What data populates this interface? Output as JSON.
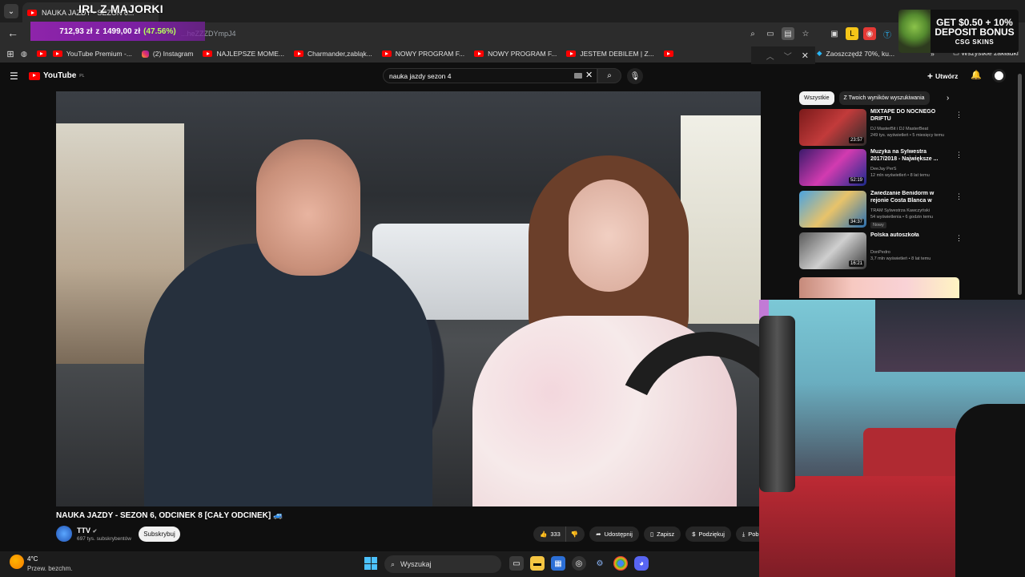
{
  "browser": {
    "tab_title": "NAUKA JAZDY - SEZON 6...",
    "address": "...heZZZDYmpJ4",
    "bookmarks": [
      {
        "label": "YouTube Premium -..."
      },
      {
        "label": "(2) Instagram"
      },
      {
        "label": "NAJLEPSZE MOME..."
      },
      {
        "label": "Charmander,zabląk..."
      },
      {
        "label": "NOWY PROGRAM F..."
      },
      {
        "label": "NOWY PROGRAM F..."
      },
      {
        "label": "JESTEM DEBILEM | Z..."
      }
    ],
    "bookmark_right": "Zaoszczędź 70%, ku...",
    "all_bookmarks": "Wszystkie zakładki"
  },
  "overlay": {
    "stream_title": "IRL Z MAJORKI",
    "donation_current": "712,93 zł",
    "donation_sep": "z",
    "donation_goal": "1499,00 zł",
    "donation_pct": "(47.56%)",
    "promo_line1": "GET $0.50 + 10%",
    "promo_line2": "DEPOSIT BONUS",
    "promo_brand": "CSG SKINS"
  },
  "youtube": {
    "logo": "YouTube",
    "logo_region": "PL",
    "search_query": "nauka jazdy sezon 4",
    "create_label": "Utwórz",
    "video_title": "NAUKA JAZDY - SEZON 6, ODCINEK 8 [CAŁY ODCINEK] 🚙",
    "channel_name": "TTV",
    "channel_subs": "697 tys. subskrybentów",
    "subscribe_label": "Subskrybuj",
    "likes": "333",
    "share_label": "Udostępnij",
    "save_label": "Zapisz",
    "thanks_label": "Podziękuj",
    "download_label": "Pob",
    "chips": [
      "Wszystkie",
      "Z Twoich wyników wyszukiwania"
    ],
    "recommendations": [
      {
        "title": "MIXTAPE DO NOCNEGO DRIFTU",
        "channel": "DJ MasterBit i DJ MasterBeat",
        "meta": "249 tys. wyświetleń • 5 miesięcy temu",
        "duration": "23:57",
        "colors": "#7a1a1a,#c23b3b,#2b2b2b",
        "badge": ""
      },
      {
        "title": "Muzyka na Sylwestra 2017/2018 - Największe ...",
        "channel": "DeeJay PerS",
        "meta": "12 mln wyświetleń • 8 lat temu",
        "duration": "52:19",
        "colors": "#3b1a6b,#d23bb0,#1a2b8b",
        "badge": ""
      },
      {
        "title": "Zwiedzanie Benidorm w rejonie Costa Blanca w Hiszpanii. ...",
        "channel": "TRAM Sylwestrza Kawczyński",
        "meta": "54 wyświetlenia • 6 godzin temu",
        "duration": "34:37",
        "colors": "#4aa3e0,#e8c36a,#2a6fb0",
        "badge": "Nowy"
      },
      {
        "title": "Polska autoszkoła",
        "channel": "DonPedro",
        "meta": "3,7 mln wyświetleń • 8 lat temu",
        "duration": "16:21",
        "colors": "#5a5a5a,#cfcfcf,#3a3a3a",
        "badge": ""
      }
    ]
  },
  "taskbar": {
    "temperature": "4°C",
    "weather": "Przew. bezchm.",
    "search_label": "Wyszukaj"
  }
}
